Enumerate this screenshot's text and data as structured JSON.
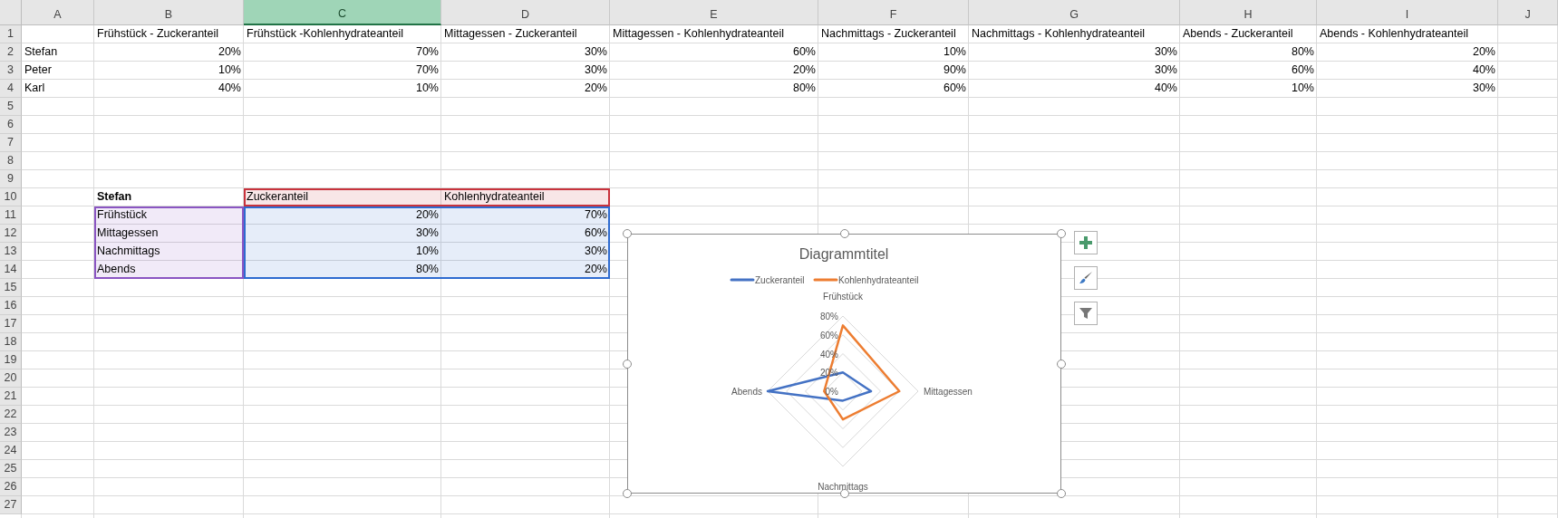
{
  "columns": [
    {
      "label": "A",
      "selected": false
    },
    {
      "label": "B",
      "selected": false
    },
    {
      "label": "C",
      "selected": true
    },
    {
      "label": "D",
      "selected": false
    },
    {
      "label": "E",
      "selected": false
    },
    {
      "label": "F",
      "selected": false
    },
    {
      "label": "G",
      "selected": false
    },
    {
      "label": "H",
      "selected": false
    },
    {
      "label": "I",
      "selected": false
    },
    {
      "label": "J",
      "selected": false
    }
  ],
  "rows": [
    {
      "number": "1",
      "cells": {
        "B": {
          "text": "Frühstück - Zuckeranteil"
        },
        "C": {
          "text": "Frühstück -Kohlenhydrateanteil"
        },
        "D": {
          "text": "Mittagessen - Zuckeranteil"
        },
        "E": {
          "text": "Mittagessen - Kohlenhydrateanteil"
        },
        "F": {
          "text": "Nachmittags - Zuckeranteil"
        },
        "G": {
          "text": "Nachmittags - Kohlenhydrateanteil"
        },
        "H": {
          "text": "Abends - Zuckeranteil"
        },
        "I": {
          "text": "Abends - Kohlenhydrateanteil"
        }
      }
    },
    {
      "number": "2",
      "cells": {
        "A": {
          "text": "Stefan"
        },
        "B": {
          "text": "20%",
          "kind": "number"
        },
        "C": {
          "text": "70%",
          "kind": "number"
        },
        "D": {
          "text": "30%",
          "kind": "number"
        },
        "E": {
          "text": "60%",
          "kind": "number"
        },
        "F": {
          "text": "10%",
          "kind": "number"
        },
        "G": {
          "text": "30%",
          "kind": "number"
        },
        "H": {
          "text": "80%",
          "kind": "number"
        },
        "I": {
          "text": "20%",
          "kind": "number"
        }
      }
    },
    {
      "number": "3",
      "cells": {
        "A": {
          "text": "Peter"
        },
        "B": {
          "text": "10%",
          "kind": "number"
        },
        "C": {
          "text": "70%",
          "kind": "number"
        },
        "D": {
          "text": "30%",
          "kind": "number"
        },
        "E": {
          "text": "20%",
          "kind": "number"
        },
        "F": {
          "text": "90%",
          "kind": "number"
        },
        "G": {
          "text": "30%",
          "kind": "number"
        },
        "H": {
          "text": "60%",
          "kind": "number"
        },
        "I": {
          "text": "40%",
          "kind": "number"
        }
      }
    },
    {
      "number": "4",
      "cells": {
        "A": {
          "text": "Karl"
        },
        "B": {
          "text": "40%",
          "kind": "number"
        },
        "C": {
          "text": "10%",
          "kind": "number"
        },
        "D": {
          "text": "20%",
          "kind": "number"
        },
        "E": {
          "text": "80%",
          "kind": "number"
        },
        "F": {
          "text": "60%",
          "kind": "number"
        },
        "G": {
          "text": "40%",
          "kind": "number"
        },
        "H": {
          "text": "10%",
          "kind": "number"
        },
        "I": {
          "text": "30%",
          "kind": "number"
        }
      }
    },
    {
      "number": "5"
    },
    {
      "number": "6"
    },
    {
      "number": "7"
    },
    {
      "number": "8"
    },
    {
      "number": "9"
    },
    {
      "number": "10",
      "cells": {
        "B": {
          "text": "Stefan",
          "bold": true
        },
        "C": {
          "text": "Zuckeranteil",
          "color": "#c8323c"
        },
        "D": {
          "text": "Kohlenhydrateanteil",
          "color": "#c8323c"
        }
      }
    },
    {
      "number": "11",
      "cells": {
        "B": {
          "text": "Frühstück",
          "color": "#8a55c2"
        },
        "C": {
          "text": "20%",
          "kind": "number",
          "color": "#2e6bd0"
        },
        "D": {
          "text": "70%",
          "kind": "number",
          "color": "#2e6bd0"
        }
      }
    },
    {
      "number": "12",
      "cells": {
        "B": {
          "text": "Mittagessen",
          "color": "#8a55c2"
        },
        "C": {
          "text": "30%",
          "kind": "number",
          "color": "#2e6bd0"
        },
        "D": {
          "text": "60%",
          "kind": "number",
          "color": "#2e6bd0"
        }
      }
    },
    {
      "number": "13",
      "cells": {
        "B": {
          "text": "Nachmittags",
          "color": "#8a55c2"
        },
        "C": {
          "text": "10%",
          "kind": "number",
          "color": "#2e6bd0"
        },
        "D": {
          "text": "30%",
          "kind": "number",
          "color": "#2e6bd0"
        }
      }
    },
    {
      "number": "14",
      "cells": {
        "B": {
          "text": "Abends",
          "color": "#8a55c2"
        },
        "C": {
          "text": "80%",
          "kind": "number",
          "color": "#2e6bd0"
        },
        "D": {
          "text": "20%",
          "kind": "number",
          "color": "#2e6bd0"
        }
      }
    },
    {
      "number": "15"
    },
    {
      "number": "16"
    },
    {
      "number": "17"
    },
    {
      "number": "18"
    },
    {
      "number": "19"
    },
    {
      "number": "20"
    },
    {
      "number": "21"
    },
    {
      "number": "22"
    },
    {
      "number": "23"
    },
    {
      "number": "24"
    },
    {
      "number": "25"
    },
    {
      "number": "26"
    },
    {
      "number": "27"
    }
  ],
  "chart": {
    "chart_data": {
      "type": "radar",
      "title": "Diagrammtitel",
      "legend": true,
      "categories": [
        "Frühstück",
        "Mittagessen",
        "Nachmittags",
        "Abends"
      ],
      "series": [
        {
          "name": "Zuckeranteil",
          "color": "#4472c4",
          "values": [
            0.2,
            0.3,
            0.1,
            0.8
          ]
        },
        {
          "name": "Kohlenhydrateanteil",
          "color": "#ed7d31",
          "values": [
            0.7,
            0.6,
            0.3,
            0.2
          ]
        }
      ],
      "ylim": [
        0,
        0.8
      ],
      "yticks": [
        {
          "value": 0,
          "label": "0%"
        },
        {
          "value": 0.2,
          "label": "20%"
        },
        {
          "value": 0.4,
          "label": "40%"
        },
        {
          "value": 0.6,
          "label": "60%"
        },
        {
          "value": 0.8,
          "label": "80%"
        }
      ]
    },
    "selected": true,
    "buttons": [
      {
        "kind": "elements"
      },
      {
        "kind": "styles"
      },
      {
        "kind": "filters"
      }
    ]
  }
}
